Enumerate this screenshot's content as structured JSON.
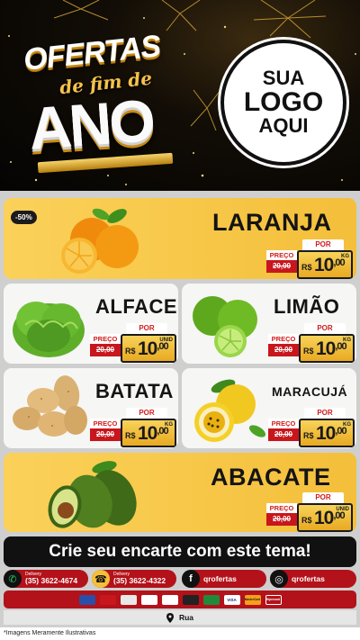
{
  "header": {
    "title_line1": "OFERTAS",
    "title_line2": "de fim de",
    "title_line3": "ANO",
    "logo_line1": "SUA",
    "logo_line2": "LOGO",
    "logo_line3": "AQUI"
  },
  "products": [
    {
      "name": "LARANJA",
      "badge": "-50%",
      "price_label": "PREÇO",
      "por_label": "POR",
      "old_price": "20,00",
      "currency": "R$",
      "price_int": "10",
      "price_dec": ",00",
      "unit": "KG",
      "icon": "orange-icon"
    },
    {
      "name": "ALFACE",
      "price_label": "PREÇO",
      "por_label": "POR",
      "old_price": "20,00",
      "currency": "R$",
      "price_int": "10",
      "price_dec": ",00",
      "unit": "UNID",
      "icon": "lettuce-icon"
    },
    {
      "name": "LIMÃO",
      "price_label": "PREÇO",
      "por_label": "POR",
      "old_price": "20,00",
      "currency": "R$",
      "price_int": "10",
      "price_dec": ",00",
      "unit": "KG",
      "icon": "lime-icon"
    },
    {
      "name": "BATATA",
      "price_label": "PREÇO",
      "por_label": "POR",
      "old_price": "20,00",
      "currency": "R$",
      "price_int": "10",
      "price_dec": ",00",
      "unit": "KG",
      "icon": "potato-icon"
    },
    {
      "name": "MARACUJÁ",
      "price_label": "PREÇO",
      "por_label": "POR",
      "old_price": "20,00",
      "currency": "R$",
      "price_int": "10",
      "price_dec": ",00",
      "unit": "KG",
      "icon": "passion-fruit-icon"
    },
    {
      "name": "ABACATE",
      "price_label": "PREÇO",
      "por_label": "POR",
      "old_price": "20,00",
      "currency": "R$",
      "price_int": "10",
      "price_dec": ",00",
      "unit": "UNID",
      "icon": "avocado-icon"
    }
  ],
  "cta": {
    "text": "Crie seu encarte com este tema!"
  },
  "contacts": [
    {
      "small": "Delivery",
      "main": "(35) 3622-4674",
      "icon": "whatsapp-icon"
    },
    {
      "small": "Delivery",
      "main": "(35) 3622-4322",
      "icon": "phone-icon"
    },
    {
      "main": "qrofertas",
      "icon": "facebook-icon"
    },
    {
      "main": "qrofertas",
      "icon": "instagram-icon"
    }
  ],
  "payment_methods": [
    "card",
    "card",
    "card",
    "card",
    "card",
    "card",
    "card",
    "VISA",
    "MasterCard",
    "Hipercard"
  ],
  "address": {
    "text": "Rua",
    "icon": "location-pin-icon"
  },
  "footnote": "*Imagens Meramente Ilustrativas",
  "colors": {
    "yellow": "#f4bf3a",
    "red": "#b3121a",
    "dark": "#111111"
  }
}
